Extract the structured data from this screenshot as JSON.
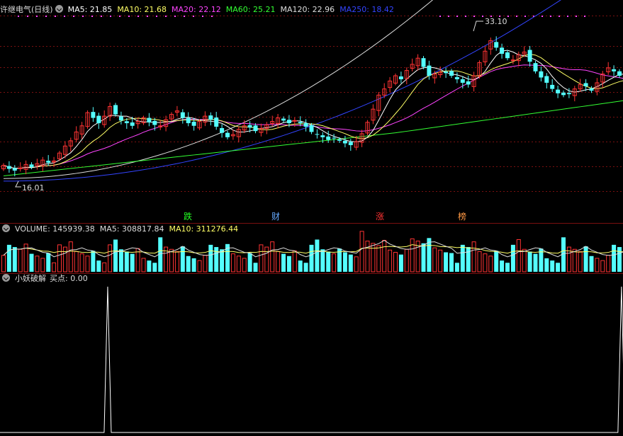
{
  "main_panel": {
    "title": "许继电气(日线)",
    "indicators": [
      {
        "label": "MA5: 21.85",
        "color": "#ffffff"
      },
      {
        "label": "MA10: 21.68",
        "color": "#ffff66"
      },
      {
        "label": "MA20: 22.12",
        "color": "#ff44ff"
      },
      {
        "label": "MA60: 25.21",
        "color": "#33ff33"
      },
      {
        "label": "MA120: 22.96",
        "color": "#dddddd"
      },
      {
        "label": "MA250: 18.42",
        "color": "#3344ff"
      }
    ],
    "high_label": "33.10",
    "low_label": "16.01",
    "event_tags": [
      {
        "text": "跌",
        "color": "#22ff22"
      },
      {
        "text": "财",
        "color": "#66aaff"
      },
      {
        "text": "涨",
        "color": "#ff3333"
      },
      {
        "text": "榜",
        "color": "#ff9944"
      }
    ]
  },
  "volume_panel": {
    "indicators": [
      {
        "label": "VOLUME: 145939.38",
        "color": "#dddddd"
      },
      {
        "label": "MA5: 308817.84",
        "color": "#dddddd"
      },
      {
        "label": "MA10: 311276.44",
        "color": "#ffff66"
      }
    ]
  },
  "indicator_panel": {
    "name": "小妖破解",
    "value_label": "买点: 0.00"
  },
  "colors": {
    "up": "#ff3333",
    "down": "#54ffff",
    "grid": "#7a1010",
    "background": "#000000"
  },
  "chart_data": {
    "type": "candlestick",
    "price_range": [
      16.01,
      33.1
    ],
    "candles_close": [
      17.8,
      17.4,
      17.2,
      17.5,
      17.9,
      17.6,
      18.0,
      18.4,
      18.1,
      18.3,
      19.2,
      20.0,
      20.6,
      21.6,
      22.3,
      23.8,
      23.2,
      22.6,
      23.4,
      24.5,
      23.6,
      22.9,
      22.6,
      22.3,
      22.8,
      23.2,
      22.7,
      22.4,
      22.3,
      23.0,
      23.6,
      24.0,
      23.2,
      22.6,
      22.3,
      22.8,
      23.4,
      23.0,
      22.2,
      21.5,
      21.0,
      21.3,
      21.9,
      22.3,
      22.1,
      21.7,
      22.0,
      22.4,
      22.8,
      23.2,
      22.9,
      22.6,
      22.9,
      22.6,
      22.2,
      21.6,
      21.3,
      21.0,
      20.7,
      20.9,
      20.6,
      20.3,
      20.1,
      20.5,
      21.4,
      22.7,
      24.2,
      25.8,
      26.5,
      27.4,
      28.0,
      27.6,
      28.6,
      29.3,
      30.0,
      29.0,
      28.0,
      28.2,
      28.4,
      28.3,
      28.0,
      27.6,
      27.2,
      27.0,
      28.0,
      29.5,
      30.8,
      32.0,
      31.2,
      30.5,
      30.0,
      29.8,
      30.4,
      30.7,
      29.6,
      28.5,
      27.8,
      27.2,
      26.5,
      26.0,
      25.8,
      25.9,
      26.5,
      27.0,
      26.8,
      26.3,
      27.2,
      28.2,
      28.9,
      28.5,
      28.0,
      27.4
    ],
    "volume_range": [
      0,
      680000
    ],
    "volume_ma5_level": 308817.84,
    "volume_ma10_level": 311276.44,
    "signal_points": [
      30,
      178
    ]
  }
}
